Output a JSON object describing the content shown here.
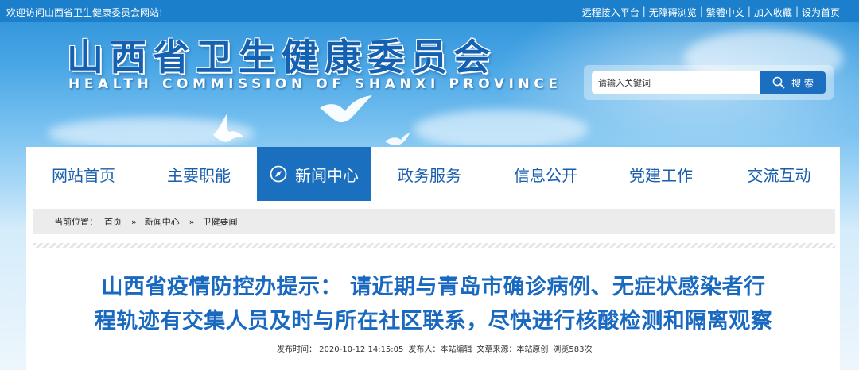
{
  "topbar": {
    "welcome": "欢迎访问山西省卫生健康委员会网站!",
    "links": [
      "远程接入平台",
      "无障碍浏览",
      "繁體中文",
      "加入收藏",
      "设为首页"
    ]
  },
  "banner": {
    "title": "山西省卫生健康委员会",
    "subtitle": "HEALTH COMMISSION OF SHANXI PROVINCE"
  },
  "search": {
    "placeholder": "请输入关键词",
    "button_label": "搜 索"
  },
  "nav": {
    "items": [
      {
        "label": "网站首页",
        "active": false
      },
      {
        "label": "主要职能",
        "active": false
      },
      {
        "label": "新闻中心",
        "active": true
      },
      {
        "label": "政务服务",
        "active": false
      },
      {
        "label": "信息公开",
        "active": false
      },
      {
        "label": "党建工作",
        "active": false
      },
      {
        "label": "交流互动",
        "active": false
      }
    ]
  },
  "breadcrumb": {
    "prefix": "当前位置：",
    "items": [
      "首页",
      "新闻中心",
      "卫健要闻"
    ],
    "separator": "»"
  },
  "article": {
    "title_line1": "山西省疫情防控办提示： 请近期与青岛市确诊病例、无症状感染者行",
    "title_line2": "程轨迹有交集人员及时与所在社区联系，尽快进行核酸检测和隔离观察",
    "published": "发布时间： 2020-10-12 14:15:05",
    "publisher": "发布人：本站编辑",
    "source": "文章来源：本站原创",
    "views": "浏览583次"
  },
  "colors": {
    "topbar": "#1c7fcc",
    "title_blue": "#1461b2",
    "nav_active": "#1a6fbf",
    "headline": "#1a69c0"
  }
}
